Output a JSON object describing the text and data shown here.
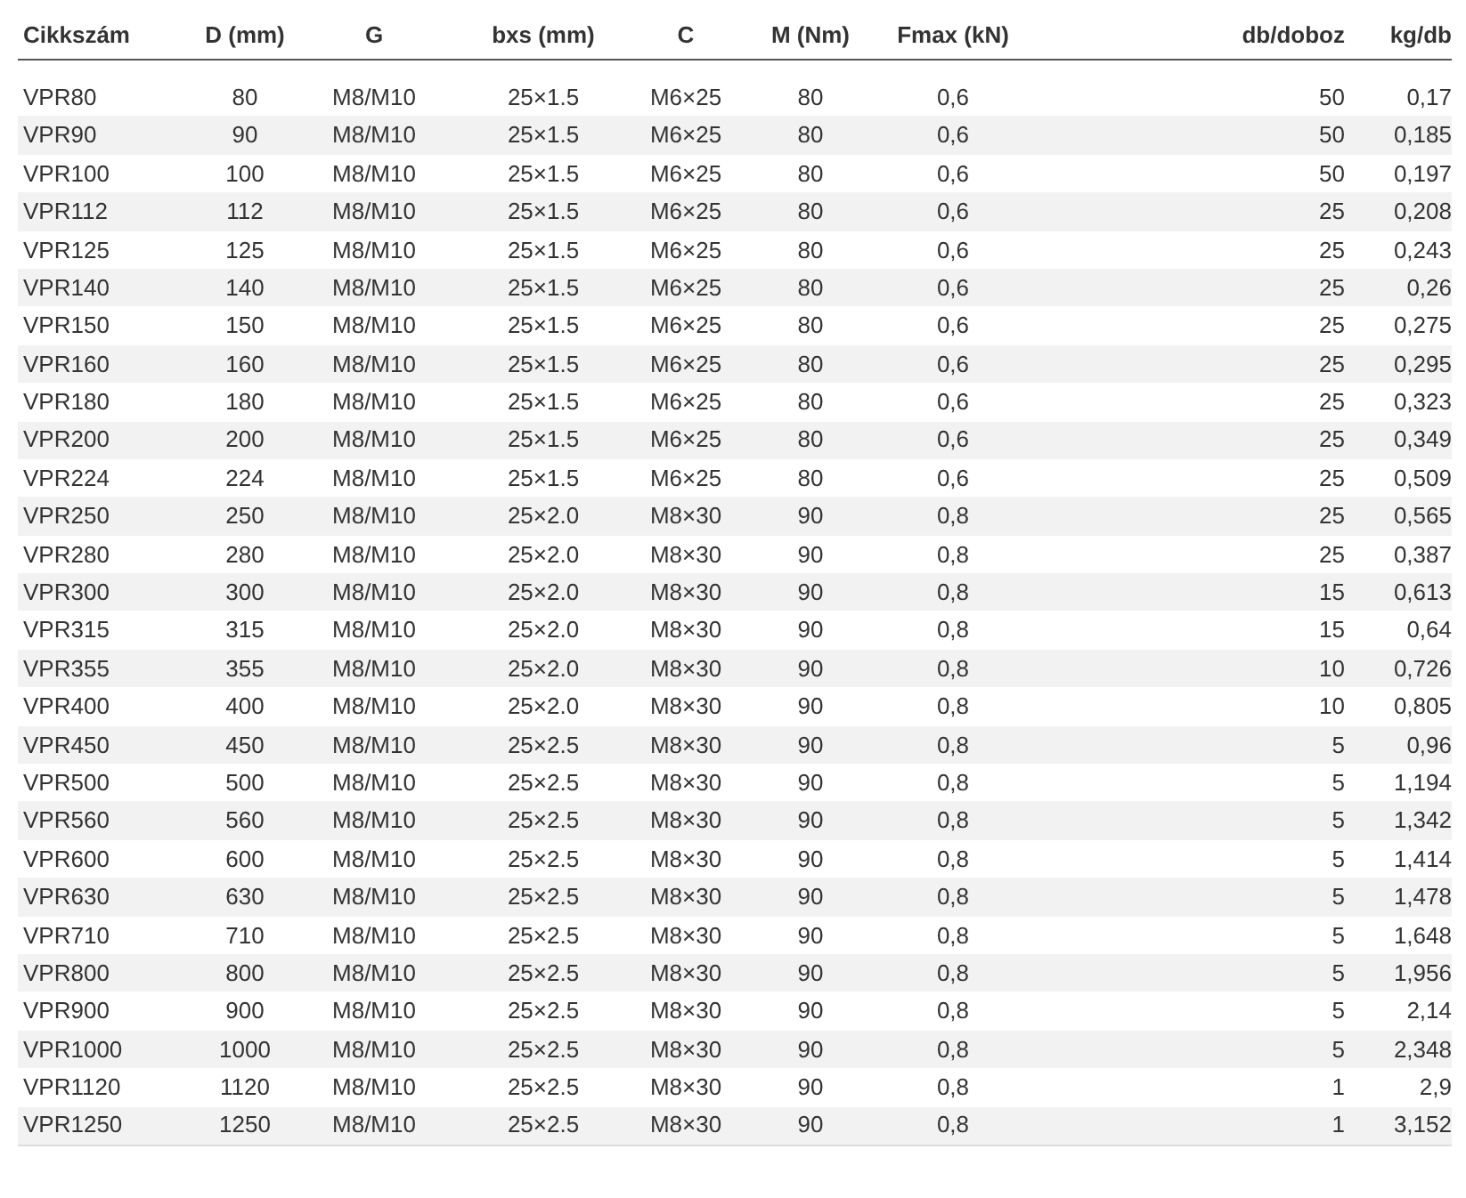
{
  "table": {
    "columns": [
      "Cikkszám",
      "D (mm)",
      "G",
      "bxs (mm)",
      "C",
      "M (Nm)",
      "Fmax (kN)",
      "db/doboz",
      "kg/db"
    ],
    "rows": [
      [
        "VPR80",
        "80",
        "M8/M10",
        "25×1.5",
        "M6×25",
        "80",
        "0,6",
        "50",
        "0,17"
      ],
      [
        "VPR90",
        "90",
        "M8/M10",
        "25×1.5",
        "M6×25",
        "80",
        "0,6",
        "50",
        "0,185"
      ],
      [
        "VPR100",
        "100",
        "M8/M10",
        "25×1.5",
        "M6×25",
        "80",
        "0,6",
        "50",
        "0,197"
      ],
      [
        "VPR112",
        "112",
        "M8/M10",
        "25×1.5",
        "M6×25",
        "80",
        "0,6",
        "25",
        "0,208"
      ],
      [
        "VPR125",
        "125",
        "M8/M10",
        "25×1.5",
        "M6×25",
        "80",
        "0,6",
        "25",
        "0,243"
      ],
      [
        "VPR140",
        "140",
        "M8/M10",
        "25×1.5",
        "M6×25",
        "80",
        "0,6",
        "25",
        "0,26"
      ],
      [
        "VPR150",
        "150",
        "M8/M10",
        "25×1.5",
        "M6×25",
        "80",
        "0,6",
        "25",
        "0,275"
      ],
      [
        "VPR160",
        "160",
        "M8/M10",
        "25×1.5",
        "M6×25",
        "80",
        "0,6",
        "25",
        "0,295"
      ],
      [
        "VPR180",
        "180",
        "M8/M10",
        "25×1.5",
        "M6×25",
        "80",
        "0,6",
        "25",
        "0,323"
      ],
      [
        "VPR200",
        "200",
        "M8/M10",
        "25×1.5",
        "M6×25",
        "80",
        "0,6",
        "25",
        "0,349"
      ],
      [
        "VPR224",
        "224",
        "M8/M10",
        "25×1.5",
        "M6×25",
        "80",
        "0,6",
        "25",
        "0,509"
      ],
      [
        "VPR250",
        "250",
        "M8/M10",
        "25×2.0",
        "M8×30",
        "90",
        "0,8",
        "25",
        "0,565"
      ],
      [
        "VPR280",
        "280",
        "M8/M10",
        "25×2.0",
        "M8×30",
        "90",
        "0,8",
        "25",
        "0,387"
      ],
      [
        "VPR300",
        "300",
        "M8/M10",
        "25×2.0",
        "M8×30",
        "90",
        "0,8",
        "15",
        "0,613"
      ],
      [
        "VPR315",
        "315",
        "M8/M10",
        "25×2.0",
        "M8×30",
        "90",
        "0,8",
        "15",
        "0,64"
      ],
      [
        "VPR355",
        "355",
        "M8/M10",
        "25×2.0",
        "M8×30",
        "90",
        "0,8",
        "10",
        "0,726"
      ],
      [
        "VPR400",
        "400",
        "M8/M10",
        "25×2.0",
        "M8×30",
        "90",
        "0,8",
        "10",
        "0,805"
      ],
      [
        "VPR450",
        "450",
        "M8/M10",
        "25×2.5",
        "M8×30",
        "90",
        "0,8",
        "5",
        "0,96"
      ],
      [
        "VPR500",
        "500",
        "M8/M10",
        "25×2.5",
        "M8×30",
        "90",
        "0,8",
        "5",
        "1,194"
      ],
      [
        "VPR560",
        "560",
        "M8/M10",
        "25×2.5",
        "M8×30",
        "90",
        "0,8",
        "5",
        "1,342"
      ],
      [
        "VPR600",
        "600",
        "M8/M10",
        "25×2.5",
        "M8×30",
        "90",
        "0,8",
        "5",
        "1,414"
      ],
      [
        "VPR630",
        "630",
        "M8/M10",
        "25×2.5",
        "M8×30",
        "90",
        "0,8",
        "5",
        "1,478"
      ],
      [
        "VPR710",
        "710",
        "M8/M10",
        "25×2.5",
        "M8×30",
        "90",
        "0,8",
        "5",
        "1,648"
      ],
      [
        "VPR800",
        "800",
        "M8/M10",
        "25×2.5",
        "M8×30",
        "90",
        "0,8",
        "5",
        "1,956"
      ],
      [
        "VPR900",
        "900",
        "M8/M10",
        "25×2.5",
        "M8×30",
        "90",
        "0,8",
        "5",
        "2,14"
      ],
      [
        "VPR1000",
        "1000",
        "M8/M10",
        "25×2.5",
        "M8×30",
        "90",
        "0,8",
        "5",
        "2,348"
      ],
      [
        "VPR1120",
        "1120",
        "M8/M10",
        "25×2.5",
        "M8×30",
        "90",
        "0,8",
        "1",
        "2,9"
      ],
      [
        "VPR1250",
        "1250",
        "M8/M10",
        "25×2.5",
        "M8×30",
        "90",
        "0,8",
        "1",
        "3,152"
      ]
    ]
  }
}
